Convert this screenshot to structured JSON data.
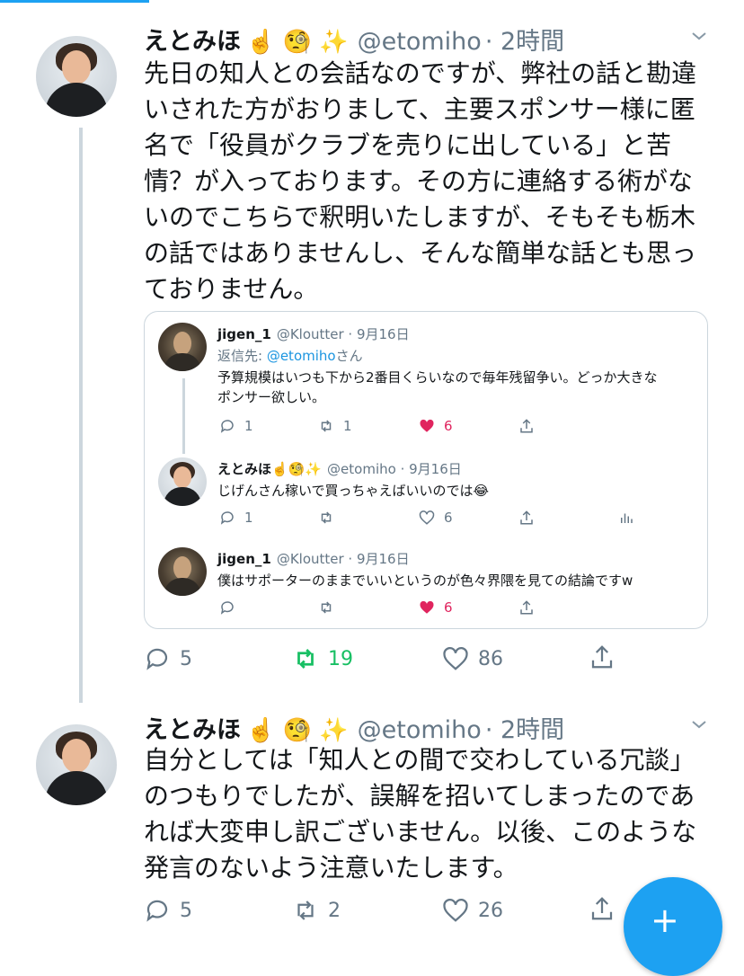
{
  "tweet1": {
    "name": "えとみほ",
    "emoji": "☝️ 🧐 ✨",
    "handle": "@etomiho",
    "time": "· 2時間",
    "text": "先日の知人との会話なのですが、弊社の話と勘違\nいされた方がおりまして、主要スポンサー様に匿\n名で「役員がクラブを売りに出している」と苦\n情？が入っております。その方に連絡する術がな\nいのでこちらで釈明いたしますが、そもそも栃木\nの話ではありませんし、そんな簡単な話とも思っ\nておりません。",
    "reply_count": "5",
    "retweet_count": "19",
    "like_count": "86"
  },
  "quote": {
    "q1": {
      "name": "jigen_1",
      "handle": "@Kloutter · 9月16日",
      "reply_prefix": "返信先: ",
      "reply_to": "@etomiho",
      "reply_suffix": "さん",
      "text": "予算規模はいつも下から2番目くらいなので毎年残留争い。どっか大きな\nポンサー欲しい。",
      "replies": "1",
      "retweets": "1",
      "likes": "6"
    },
    "q2": {
      "name": "えとみほ",
      "emoji": "☝️🧐✨",
      "handle": "@etomiho · 9月16日",
      "text": "じげんさん稼いで買っちゃえばいいのでは😂",
      "replies": "1",
      "likes": "6"
    },
    "q3": {
      "name": "jigen_1",
      "handle": "@Kloutter · 9月16日",
      "text": "僕はサポーターのままでいいというのが色々界隈を見ての結論ですw",
      "likes": "6"
    }
  },
  "tweet2": {
    "name": "えとみほ",
    "emoji": "☝️ 🧐 ✨",
    "handle": "@etomiho",
    "time": "· 2時間",
    "text": "自分としては「知人との間で交わしている冗談」\nのつもりでしたが、誤解を招いてしまったのであ\nれば大変申し訳ございません。以後、このような\n発言のないよう注意いたします。",
    "reply_count": "5",
    "retweet_count": "2",
    "like_count": "26"
  },
  "colors": {
    "accent": "#1da1f2",
    "like": "#e0245e",
    "retweet": "#17bf63",
    "muted": "#657786"
  },
  "fab": {
    "icon": "compose-feather-icon",
    "symbol": "+"
  }
}
